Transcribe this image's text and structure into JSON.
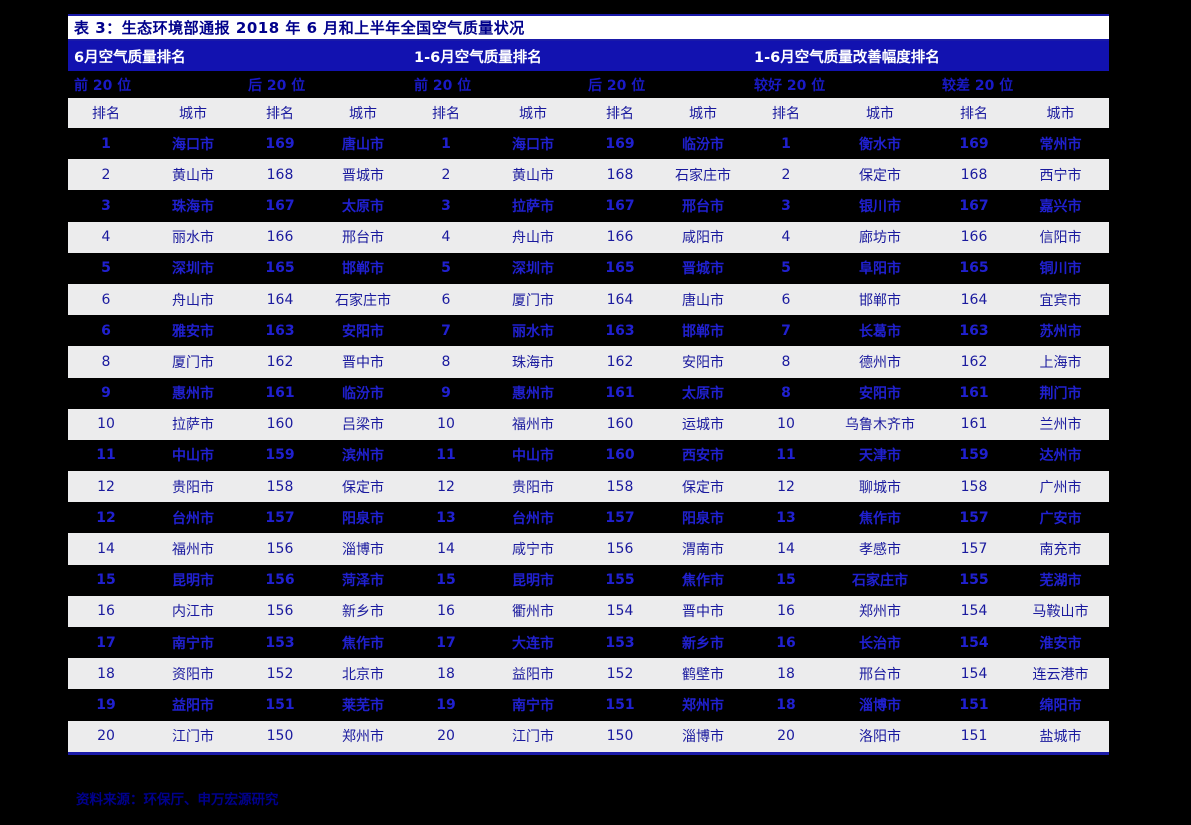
{
  "title": "表 3：生态环境部通报 2018 年 6 月和上半年全国空气质量状况",
  "groups": [
    {
      "label": "6月空气质量排名"
    },
    {
      "label": "1-6月空气质量排名"
    },
    {
      "label": "1-6月空气质量改善幅度排名"
    }
  ],
  "subheaders": [
    {
      "label": "前 20 位"
    },
    {
      "label": "后 20 位"
    },
    {
      "label": "前 20 位"
    },
    {
      "label": "后 20 位"
    },
    {
      "label": "较好 20 位"
    },
    {
      "label": "较差 20 位"
    }
  ],
  "column_headers": [
    "排名",
    "城市",
    "排名",
    "城市",
    "排名",
    "城市",
    "排名",
    "城市",
    "排名",
    "城市",
    "排名",
    "城市"
  ],
  "colors": {
    "title_text": "#00008B",
    "group_band": "#1212b0",
    "group_text": "#ffffff",
    "sub_text": "#1919c4",
    "colhead_bg": "#ececed",
    "row_odd_bg": "#000000",
    "row_even_bg": "#ececed",
    "text_blue": "#1a1a9e",
    "text_blue_bright": "#2020cf",
    "rule": "#1a1aa8",
    "page_bg": "#000000"
  },
  "source": "资料来源：环保厅、申万宏源研究",
  "chart_data": {
    "type": "table",
    "title": "表 3：生态环境部通报 2018 年 6 月和上半年全国空气质量状况",
    "columns": [
      "排名",
      "城市",
      "排名",
      "城市",
      "排名",
      "城市",
      "排名",
      "城市",
      "排名",
      "城市",
      "排名",
      "城市"
    ],
    "rows": [
      [
        "1",
        "海口市",
        "169",
        "唐山市",
        "1",
        "海口市",
        "169",
        "临汾市",
        "1",
        "衡水市",
        "169",
        "常州市"
      ],
      [
        "2",
        "黄山市",
        "168",
        "晋城市",
        "2",
        "黄山市",
        "168",
        "石家庄市",
        "2",
        "保定市",
        "168",
        "西宁市"
      ],
      [
        "3",
        "珠海市",
        "167",
        "太原市",
        "3",
        "拉萨市",
        "167",
        "邢台市",
        "3",
        "银川市",
        "167",
        "嘉兴市"
      ],
      [
        "4",
        "丽水市",
        "166",
        "邢台市",
        "4",
        "舟山市",
        "166",
        "咸阳市",
        "4",
        "廊坊市",
        "166",
        "信阳市"
      ],
      [
        "5",
        "深圳市",
        "165",
        "邯郸市",
        "5",
        "深圳市",
        "165",
        "晋城市",
        "5",
        "阜阳市",
        "165",
        "铜川市"
      ],
      [
        "6",
        "舟山市",
        "164",
        "石家庄市",
        "6",
        "厦门市",
        "164",
        "唐山市",
        "6",
        "邯郸市",
        "164",
        "宜宾市"
      ],
      [
        "6",
        "雅安市",
        "163",
        "安阳市",
        "7",
        "丽水市",
        "163",
        "邯郸市",
        "7",
        "长葛市",
        "163",
        "苏州市"
      ],
      [
        "8",
        "厦门市",
        "162",
        "晋中市",
        "8",
        "珠海市",
        "162",
        "安阳市",
        "8",
        "德州市",
        "162",
        "上海市"
      ],
      [
        "9",
        "惠州市",
        "161",
        "临汾市",
        "9",
        "惠州市",
        "161",
        "太原市",
        "8",
        "安阳市",
        "161",
        "荆门市"
      ],
      [
        "10",
        "拉萨市",
        "160",
        "吕梁市",
        "10",
        "福州市",
        "160",
        "运城市",
        "10",
        "乌鲁木齐市",
        "161",
        "兰州市"
      ],
      [
        "11",
        "中山市",
        "159",
        "滨州市",
        "11",
        "中山市",
        "160",
        "西安市",
        "11",
        "天津市",
        "159",
        "达州市"
      ],
      [
        "12",
        "贵阳市",
        "158",
        "保定市",
        "12",
        "贵阳市",
        "158",
        "保定市",
        "12",
        "聊城市",
        "158",
        "广州市"
      ],
      [
        "12",
        "台州市",
        "157",
        "阳泉市",
        "13",
        "台州市",
        "157",
        "阳泉市",
        "13",
        "焦作市",
        "157",
        "广安市"
      ],
      [
        "14",
        "福州市",
        "156",
        "淄博市",
        "14",
        "咸宁市",
        "156",
        "渭南市",
        "14",
        "孝感市",
        "157",
        "南充市"
      ],
      [
        "15",
        "昆明市",
        "156",
        "菏泽市",
        "15",
        "昆明市",
        "155",
        "焦作市",
        "15",
        "石家庄市",
        "155",
        "芜湖市"
      ],
      [
        "16",
        "内江市",
        "156",
        "新乡市",
        "16",
        "衢州市",
        "154",
        "晋中市",
        "16",
        "郑州市",
        "154",
        "马鞍山市"
      ],
      [
        "17",
        "南宁市",
        "153",
        "焦作市",
        "17",
        "大连市",
        "153",
        "新乡市",
        "16",
        "长治市",
        "154",
        "淮安市"
      ],
      [
        "18",
        "资阳市",
        "152",
        "北京市",
        "18",
        "益阳市",
        "152",
        "鹤壁市",
        "18",
        "邢台市",
        "154",
        "连云港市"
      ],
      [
        "19",
        "益阳市",
        "151",
        "莱芜市",
        "19",
        "南宁市",
        "151",
        "郑州市",
        "18",
        "淄博市",
        "151",
        "绵阳市"
      ],
      [
        "20",
        "江门市",
        "150",
        "郑州市",
        "20",
        "江门市",
        "150",
        "淄博市",
        "20",
        "洛阳市",
        "151",
        "盐城市"
      ]
    ]
  }
}
